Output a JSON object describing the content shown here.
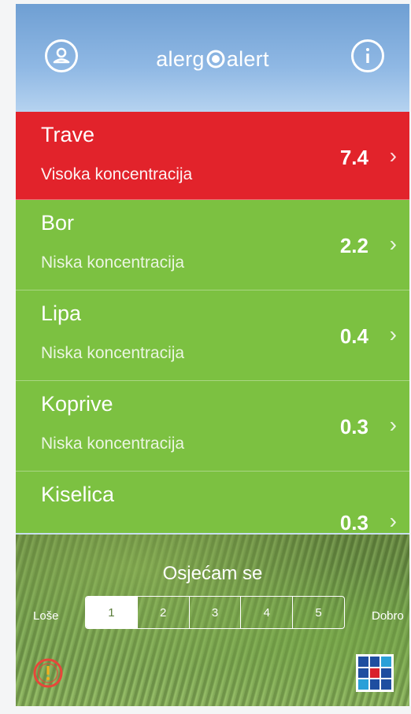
{
  "header": {
    "logo_left": "alerg",
    "logo_right": "alert",
    "profile_icon": "user-circle-icon",
    "info_icon": "info-circle-icon"
  },
  "allergens": [
    {
      "name": "Trave",
      "level": "Visoka koncentracija",
      "value": "7.4",
      "status": "high"
    },
    {
      "name": "Bor",
      "level": "Niska koncentracija",
      "value": "2.2",
      "status": "low"
    },
    {
      "name": "Lipa",
      "level": "Niska koncentracija",
      "value": "0.4",
      "status": "low"
    },
    {
      "name": "Koprive",
      "level": "Niska koncentracija",
      "value": "0.3",
      "status": "low"
    },
    {
      "name": "Kiselica",
      "level": "",
      "value": "0.3",
      "status": "low"
    }
  ],
  "feeling": {
    "label": "Osjećam se",
    "low_label": "Loše",
    "high_label": "Dobro",
    "options": [
      "1",
      "2",
      "3",
      "4",
      "5"
    ],
    "selected": "1"
  },
  "footer": {
    "alert_icon": "alert-circle-icon",
    "app_icon": "grid-logo-icon"
  },
  "colors": {
    "high": "#e2232b",
    "low": "#7cc141"
  }
}
